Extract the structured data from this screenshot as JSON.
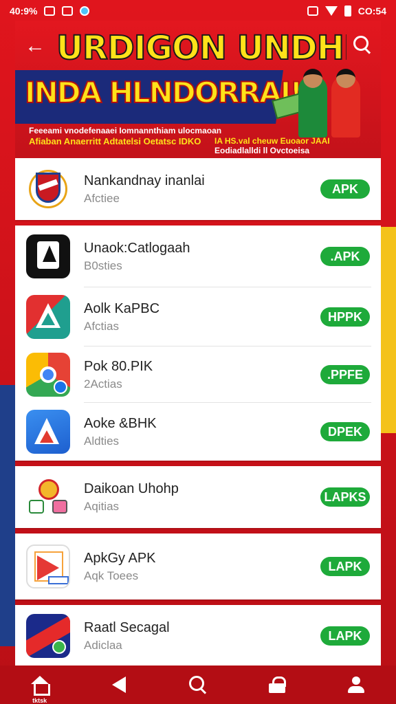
{
  "status_bar": {
    "time_left": "40:9%",
    "time_right": "CO:54"
  },
  "header": {
    "title": "URDIGON UNDHEAN",
    "subtitle": "INDA HLNDORRAI!",
    "tagline_line1": "Feeeami vnodefenaaei Iomnannthiam ulocmaoan",
    "tagline_line2": "Afiaban Anaerritt Adtatelsi Oetatsc IDKO",
    "tagline2_line1": "IA HS.val cheuw Euoaor JAAI",
    "tagline2_line2": "Eodiadlalldi ll Ovctoeisa"
  },
  "apps": [
    {
      "name": "Nankandnay inanlai",
      "sub": "Afctiee",
      "button": "APK",
      "icon": "crest-icon"
    },
    {
      "name": "Unaok:Catlogaah",
      "sub": "B0sties",
      "button": ".APK",
      "icon": "document-icon"
    },
    {
      "name": "Aolk KaPBC",
      "sub": "Afctias",
      "button": "HPPK",
      "icon": "triangle-icon"
    },
    {
      "name": "Pok 80.PIK",
      "sub": "2Actias",
      "button": ".PPFE",
      "icon": "chrome-icon"
    },
    {
      "name": "Aoke &BHK",
      "sub": "Aldties",
      "button": "DPEK",
      "icon": "app-store-icon"
    },
    {
      "name": "Daikoan Uhohp",
      "sub": "Aqitias",
      "button": "LAPKS",
      "icon": "mascot-icon"
    },
    {
      "name": "ApkGy APK",
      "sub": "Aqk Toees",
      "button": "LAPK",
      "icon": "play-store-icon"
    },
    {
      "name": "Raatl Secagal",
      "sub": "Adiclaa",
      "button": "LAPK",
      "icon": "game-icon"
    }
  ],
  "bottom_nav": {
    "home_label": "tktsk",
    "items": [
      "home-icon",
      "back-icon",
      "search-icon",
      "lock-icon",
      "user-icon"
    ]
  },
  "colors": {
    "primary_red": "#d4141b",
    "apk_green": "#1eaa3a",
    "title_yellow": "#ffe21a"
  }
}
